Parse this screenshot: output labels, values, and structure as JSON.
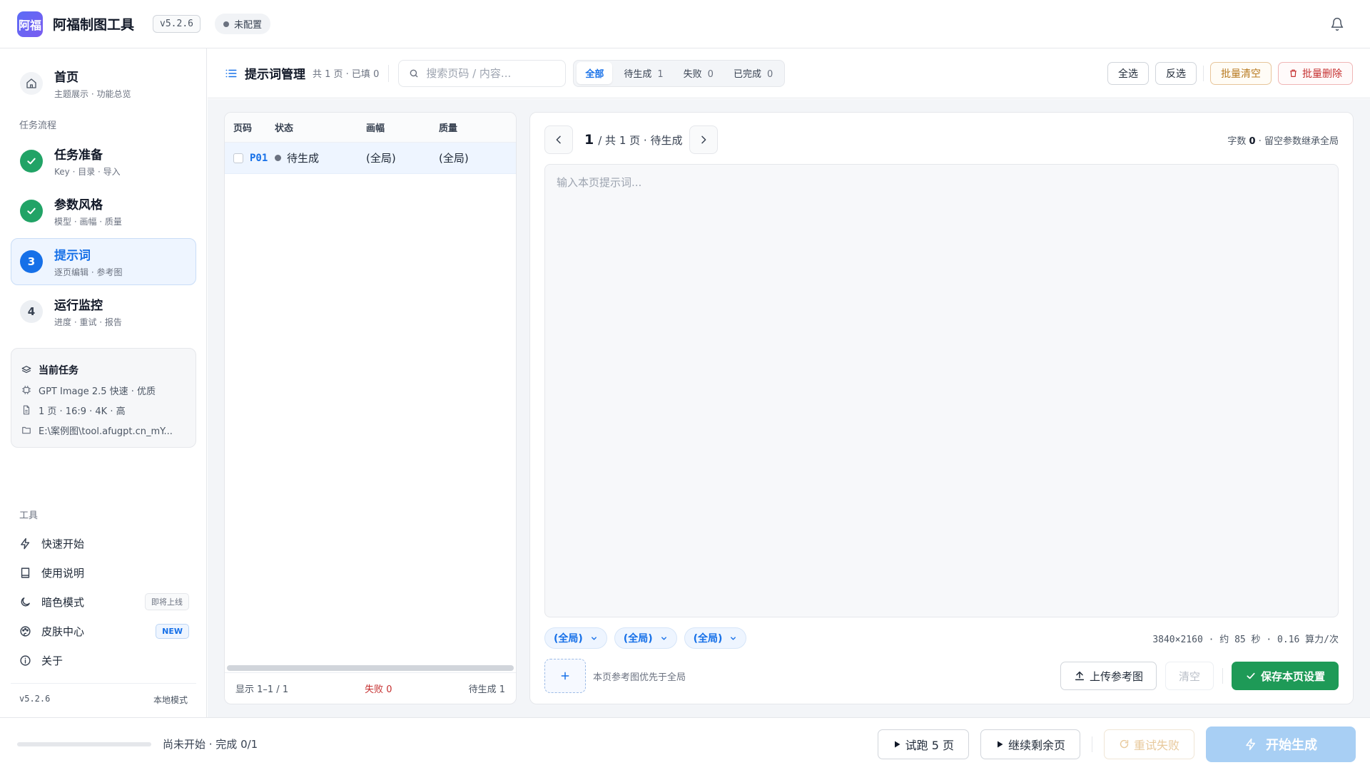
{
  "titlebar": {
    "logo_text": "阿福",
    "title": "阿福制图工具",
    "version": "v5.2.6",
    "status": "未配置"
  },
  "sidebar": {
    "home": {
      "title": "首页",
      "sub": "主题展示 · 功能总览"
    },
    "flow_label": "任务流程",
    "steps": [
      {
        "num": "",
        "title": "任务准备",
        "sub": "Key · 目录 · 导入",
        "state": "done"
      },
      {
        "num": "",
        "title": "参数风格",
        "sub": "模型 · 画幅 · 质量",
        "state": "done"
      },
      {
        "num": "3",
        "title": "提示词",
        "sub": "逐页编辑 · 参考图",
        "state": "current"
      },
      {
        "num": "4",
        "title": "运行监控",
        "sub": "进度 · 重试 · 报告",
        "state": "todo"
      }
    ],
    "current_task": {
      "title": "当前任务",
      "model": "GPT Image 2.5 快速 · 优质",
      "spec": "1 页 · 16:9 · 4K · 高",
      "path": "E:\\案例图\\tool.afugpt.cn_mY..."
    },
    "tools_label": "工具",
    "tools": [
      {
        "label": "快速开始",
        "badge": ""
      },
      {
        "label": "使用说明",
        "badge": ""
      },
      {
        "label": "暗色模式",
        "badge": "即将上线"
      },
      {
        "label": "皮肤中心",
        "badge": "NEW"
      },
      {
        "label": "关于",
        "badge": ""
      }
    ],
    "footer": {
      "version": "v5.2.6",
      "mode": "本地模式"
    }
  },
  "toolbar": {
    "title": "提示词管理",
    "meta": "共 1 页 · 已填 0",
    "search_placeholder": "搜索页码 / 内容...",
    "filters": [
      {
        "label": "全部",
        "count": ""
      },
      {
        "label": "待生成",
        "count": "1"
      },
      {
        "label": "失败",
        "count": "0"
      },
      {
        "label": "已完成",
        "count": "0"
      }
    ],
    "select_all": "全选",
    "invert": "反选",
    "batch_clear": "批量清空",
    "batch_delete": "批量删除"
  },
  "list": {
    "headers": {
      "page": "页码",
      "status": "状态",
      "size": "画幅",
      "quality": "质量"
    },
    "rows": [
      {
        "page": "P01",
        "status": "待生成",
        "size": "(全局)",
        "quality": "(全局)"
      }
    ],
    "footer": {
      "showing": "显示 1–1 / 1",
      "failed": "失败 0",
      "pending": "待生成 1"
    }
  },
  "editor": {
    "page_num": "1",
    "page_info": "/ 共 1 页 · 待生成",
    "char_label": "字数",
    "char_count": "0",
    "char_hint": "· 留空参数继承全局",
    "prompt_placeholder": "输入本页提示词...",
    "chips": [
      "(全局)",
      "(全局)",
      "(全局)"
    ],
    "cost_info": "3840×2160 · 约 85 秒 · 0.16 算力/次",
    "ref_hint": "本页参考图优先于全局",
    "upload_ref": "上传参考图",
    "clear": "清空",
    "save": "保存本页设置"
  },
  "bottombar": {
    "progress": 0,
    "progress_text": "尚未开始 · 完成 0/1",
    "trial": "试跑 5 页",
    "continue": "继续剩余页",
    "retry_failed": "重试失败",
    "start": "开始生成"
  },
  "colors": {
    "accent": "#1670e8",
    "success": "#21a366",
    "save_button": "#1e9a57",
    "danger": "#c53030",
    "warning": "#b7791f"
  }
}
